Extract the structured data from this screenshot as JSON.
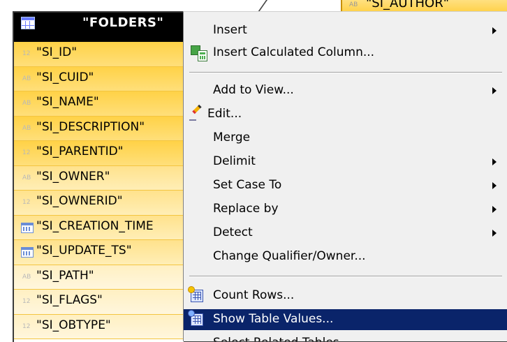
{
  "background_table": {
    "type_label": "AB",
    "column": "\"SI_AUTHOR\""
  },
  "table": {
    "title": "\"FOLDERS\"",
    "columns": [
      {
        "type": "12",
        "name": "\"SI_ID\""
      },
      {
        "type": "AB",
        "name": "\"SI_CUID\""
      },
      {
        "type": "AB",
        "name": "\"SI_NAME\""
      },
      {
        "type": "AB",
        "name": "\"SI_DESCRIPTION\""
      },
      {
        "type": "12",
        "name": "\"SI_PARENTID\""
      },
      {
        "type": "AB",
        "name": "\"SI_OWNER\""
      },
      {
        "type": "12",
        "name": "\"SI_OWNERID\""
      },
      {
        "type": "date-icon",
        "name": "\"SI_CREATION_TIME"
      },
      {
        "type": "date-icon",
        "name": "\"SI_UPDATE_TS\""
      },
      {
        "type": "AB",
        "name": "\"SI_PATH\""
      },
      {
        "type": "12",
        "name": "\"SI_FLAGS\""
      },
      {
        "type": "12",
        "name": "\"SI_OBTYPE\""
      }
    ]
  },
  "menu": {
    "items": {
      "insert": "Insert",
      "insert_calculated_column": "Insert Calculated Column...",
      "add_to_view": "Add to View...",
      "edit": "Edit...",
      "merge": "Merge",
      "delimit": "Delimit",
      "set_case_to": "Set Case To",
      "replace_by": "Replace by",
      "detect": "Detect",
      "change_qualifier_owner": "Change Qualifier/Owner...",
      "count_rows": "Count Rows...",
      "show_table_values": "Show Table Values...",
      "select_related_tables": "Select Related Tables"
    },
    "selected": "show_table_values"
  },
  "colors": {
    "selection": "#0a246a",
    "menu_bg": "#f0f0f0",
    "table_header": "#000000",
    "row_fill": "#ffd247"
  }
}
